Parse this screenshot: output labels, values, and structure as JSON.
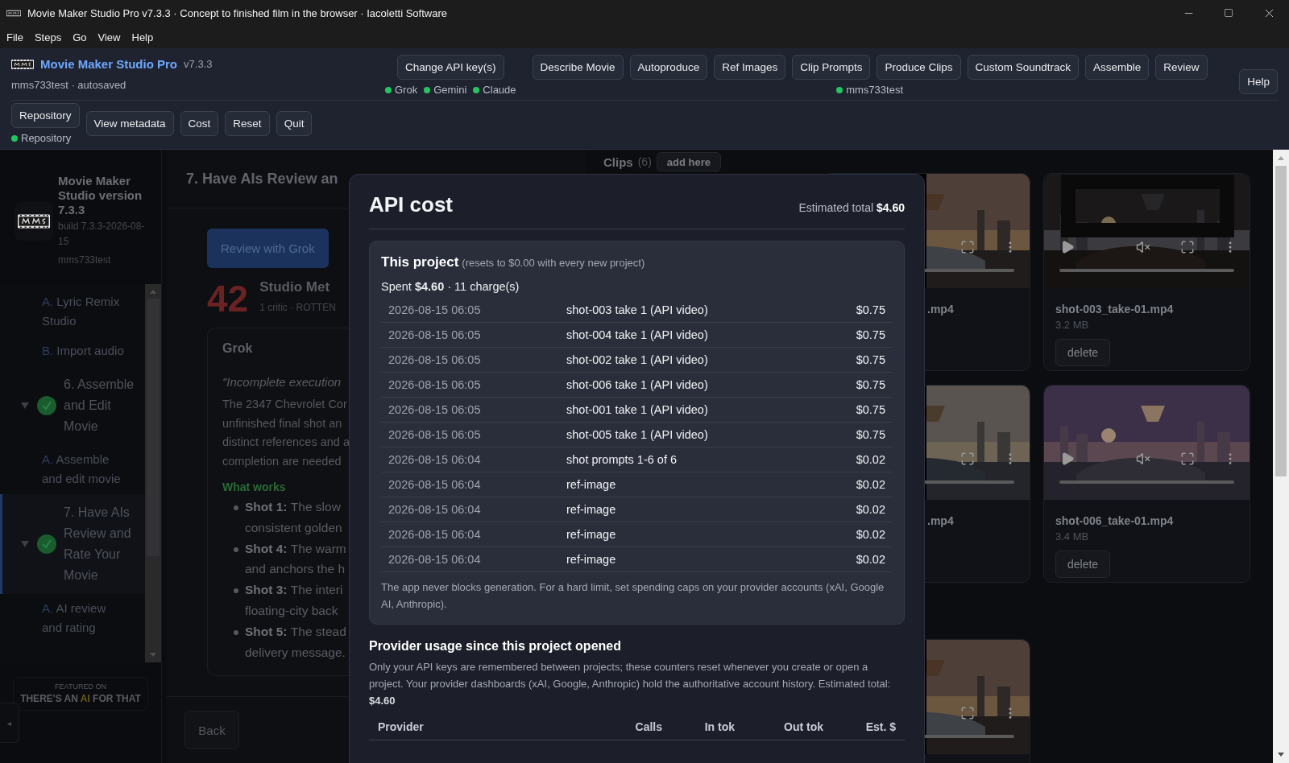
{
  "window": {
    "title": "Movie Maker Studio Pro v7.3.3 · Concept to finished film in the browser · Iacoletti Software"
  },
  "menu": [
    "File",
    "Steps",
    "Go",
    "View",
    "Help"
  ],
  "header": {
    "app_name": "Movie Maker Studio Pro",
    "version": "v7.3.3",
    "project": "mms733test · autosaved",
    "api_button": "Change API key(s)",
    "providers": [
      {
        "label": "Grok",
        "ok": true
      },
      {
        "label": "Gemini",
        "ok": true
      },
      {
        "label": "Claude",
        "ok": true
      }
    ],
    "steps": [
      "Describe Movie",
      "Autoproduce",
      "Ref Images",
      "Clip Prompts",
      "Produce Clips",
      "Custom Soundtrack",
      "Assemble",
      "Review"
    ],
    "account": {
      "label": "mms733test",
      "ok": true
    },
    "help": "Help",
    "repository": {
      "button": "Repository",
      "status": {
        "label": "Repository",
        "ok": true
      }
    },
    "actions": [
      "View metadata",
      "Cost",
      "Reset",
      "Quit"
    ]
  },
  "sidebar": {
    "title": "Movie Maker Studio version 7.3.3",
    "build": "build 7.3.3-2026-08-15",
    "user": "mms733test",
    "nav": [
      {
        "kind": "sub",
        "letter": "A.",
        "label": "Lyric Remix Studio",
        "selected": false
      },
      {
        "kind": "sub",
        "letter": "B.",
        "label": "Import audio",
        "selected": false
      },
      {
        "kind": "step",
        "label": "6. Assemble and Edit Movie",
        "done": true,
        "expanded": true,
        "selected": false,
        "children": [
          {
            "letter": "A.",
            "label": "Assemble and edit movie",
            "selected": false
          }
        ]
      },
      {
        "kind": "step",
        "label": "7. Have AIs Review and Rate Your Movie",
        "done": true,
        "expanded": true,
        "selected": true,
        "children": [
          {
            "letter": "A.",
            "label": "AI review and rating",
            "selected": false
          }
        ]
      }
    ],
    "featured": {
      "caption": "FEATURED ON",
      "brand": [
        {
          "text": "THERE'S AN",
          "highlight": false
        },
        {
          "text": "AI",
          "highlight": true
        },
        {
          "text": "FOR THAT",
          "highlight": false
        }
      ]
    },
    "collapse": "◂"
  },
  "review": {
    "heading": "7. Have AIs Review an",
    "review_button": "Review with Grok",
    "score": "42",
    "score_title": "Studio Met",
    "score_caption": "1 critic · ROTTEN",
    "card": {
      "title": "Grok",
      "quote": "\"Incomplete execution",
      "lines": [
        "The 2347 Chevrolet Cor",
        "unfinished final shot an",
        "distinct references and a",
        "completion are needed"
      ],
      "works_heading": "What works",
      "bullets": [
        {
          "label": "Shot 1:",
          "lines": [
            "The slow",
            "consistent golden"
          ]
        },
        {
          "label": "Shot 4:",
          "lines": [
            "The warm",
            "and anchors the h"
          ]
        },
        {
          "label": "Shot 3:",
          "lines": [
            "The interi",
            "floating-city back"
          ]
        },
        {
          "label": "Shot 5:",
          "lines": [
            "The stead",
            "delivery message."
          ]
        }
      ]
    },
    "back": "Back"
  },
  "clips": {
    "title": "Clips",
    "count": "(6)",
    "add": "add here",
    "rows": [
      [
        {
          "name": ".mp4",
          "thumbnail": {
            "kind": "picture"
          }
        },
        {
          "name": "shot-003_take-01.mp4",
          "size": "3.2 MB",
          "delete": "delete",
          "thumbnail": {
            "kind": "picture"
          }
        }
      ],
      [
        {
          "name": ".mp4",
          "thumbnail": {
            "kind": "picture"
          }
        },
        {
          "name": "shot-006_take-01.mp4",
          "size": "3.4 MB",
          "delete": "delete",
          "thumbnail": {
            "kind": "picture"
          }
        }
      ],
      [
        {
          "thumbnail": {
            "kind": "picture"
          }
        }
      ]
    ]
  },
  "modal": {
    "title": "API cost",
    "total_label": "Estimated total",
    "total": "$4.60",
    "project": {
      "title": "This project",
      "note": "(resets to $0.00 with every new project)",
      "spent": "Spent **$4.60** · 11 charge(s)",
      "charges": [
        {
          "time": "2026-08-15 06:05",
          "item": "shot-003 take 1 (API video)",
          "cost": "$0.75"
        },
        {
          "time": "2026-08-15 06:05",
          "item": "shot-004 take 1 (API video)",
          "cost": "$0.75"
        },
        {
          "time": "2026-08-15 06:05",
          "item": "shot-002 take 1 (API video)",
          "cost": "$0.75"
        },
        {
          "time": "2026-08-15 06:05",
          "item": "shot-006 take 1 (API video)",
          "cost": "$0.75"
        },
        {
          "time": "2026-08-15 06:05",
          "item": "shot-001 take 1 (API video)",
          "cost": "$0.75"
        },
        {
          "time": "2026-08-15 06:05",
          "item": "shot-005 take 1 (API video)",
          "cost": "$0.75"
        },
        {
          "time": "2026-08-15 06:04",
          "item": "shot prompts 1-6 of 6",
          "cost": "$0.02"
        },
        {
          "time": "2026-08-15 06:04",
          "item": "ref-image",
          "cost": "$0.02"
        },
        {
          "time": "2026-08-15 06:04",
          "item": "ref-image",
          "cost": "$0.02"
        },
        {
          "time": "2026-08-15 06:04",
          "item": "ref-image",
          "cost": "$0.02"
        },
        {
          "time": "2026-08-15 06:04",
          "item": "ref-image",
          "cost": "$0.02"
        }
      ],
      "footnote": "The app never blocks generation. For a hard limit, set spending caps on your provider accounts (xAI, Google AI, Anthropic)."
    },
    "usage": {
      "title": "Provider usage since this project opened",
      "text": "Only your API keys are remembered between projects; these counters reset whenever you create or open a project. Your provider dashboards (xAI, Google, Anthropic) hold the authoritative account history. Estimated total: **$4.60**",
      "columns": [
        "Provider",
        "Calls",
        "In tok",
        "Out tok",
        "Est. $"
      ]
    }
  }
}
